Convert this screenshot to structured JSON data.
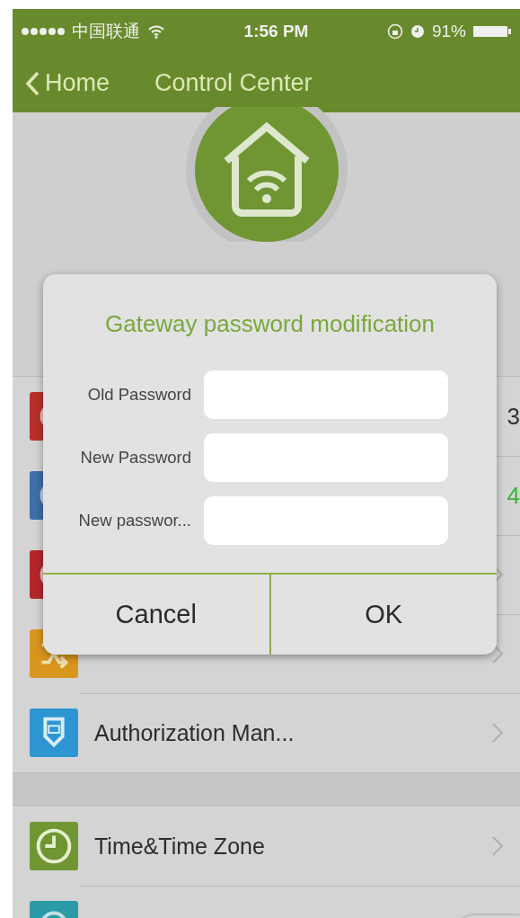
{
  "status_bar": {
    "carrier": "中国联通",
    "time": "1:56 PM",
    "battery": "91%"
  },
  "nav": {
    "back": "Home",
    "title": "Control Center"
  },
  "sections": [
    {
      "rows": [
        {
          "kind": "value",
          "color": "#b8302c",
          "value": "3",
          "value_highlight": false
        },
        {
          "kind": "value",
          "color": "#3f6ea8",
          "value": "4",
          "value_highlight": true
        },
        {
          "kind": "link",
          "color": "#b5262a"
        },
        {
          "kind": "link",
          "color": "#d9961e"
        },
        {
          "kind": "link",
          "color": "#2d96d2",
          "label": "Authorization Man..."
        }
      ]
    },
    {
      "rows": [
        {
          "kind": "link",
          "color": "#6f9632",
          "label": "Time&Time Zone"
        },
        {
          "kind": "toggle",
          "color": "#2a9aa6",
          "on": false
        }
      ]
    }
  ],
  "dialog": {
    "title": "Gateway password modification",
    "fields": [
      {
        "label": "Old Password"
      },
      {
        "label": "New Password"
      },
      {
        "label": "New passwor..."
      }
    ],
    "buttons": [
      "Cancel",
      "OK"
    ]
  }
}
